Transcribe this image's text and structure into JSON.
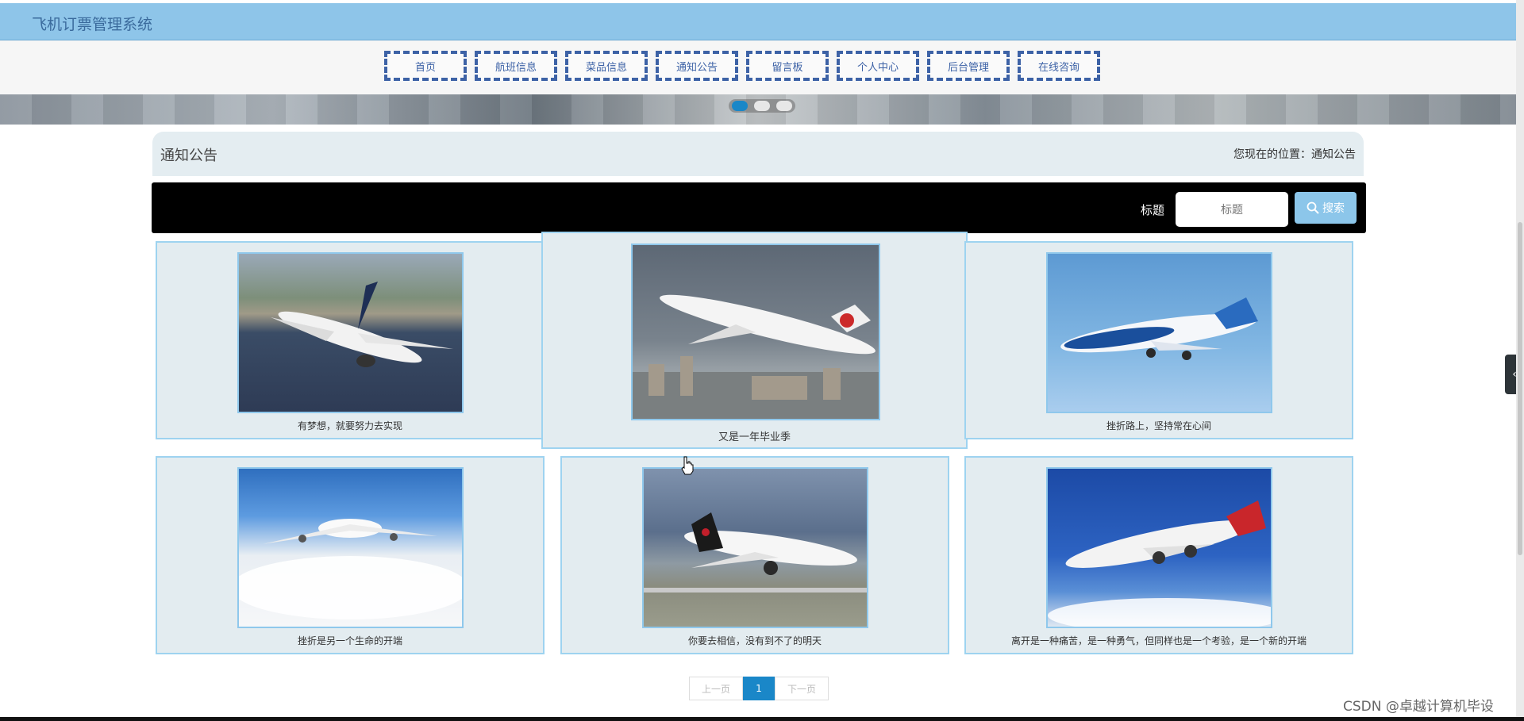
{
  "app": {
    "title": "飞机订票管理系统"
  },
  "nav": [
    "首页",
    "航班信息",
    "菜品信息",
    "通知公告",
    "留言板",
    "个人中心",
    "后台管理",
    "在线咨询"
  ],
  "banner": {
    "slide_count": 3,
    "active_index": 0
  },
  "section": {
    "title": "通知公告",
    "breadcrumb": "您现在的位置：通知公告"
  },
  "search": {
    "label": "标题",
    "placeholder": "标题",
    "button": "搜索"
  },
  "cards": [
    {
      "caption": "有梦想，就要努力去实现",
      "image": "sukhoi-jet-over-bay"
    },
    {
      "caption": "又是一年毕业季",
      "image": "air-china-747-takeoff"
    },
    {
      "caption": "挫折路上，坚持常在心间",
      "image": "boeing-747-blue-livery"
    },
    {
      "caption": "挫折是另一个生命的开端",
      "image": "a340-above-clouds"
    },
    {
      "caption": "你要去相信，没有到不了的明天",
      "image": "air-canada-787-landing"
    },
    {
      "caption": "离开是一种痛苦，是一种勇气，但同样也是一个考验，是一个新的开端",
      "image": "qantas-747-blue-sky"
    }
  ],
  "pagination": {
    "prev": "上一页",
    "current": "1",
    "next": "下一页"
  },
  "sidebar_toggle": "‹",
  "watermark": "CSDN @卓越计算机毕设",
  "colors": {
    "accent": "#1a87c8",
    "topbar": "#8ec5e9",
    "nav_border": "#3d62a6",
    "card_bg": "#e3ecf0"
  }
}
